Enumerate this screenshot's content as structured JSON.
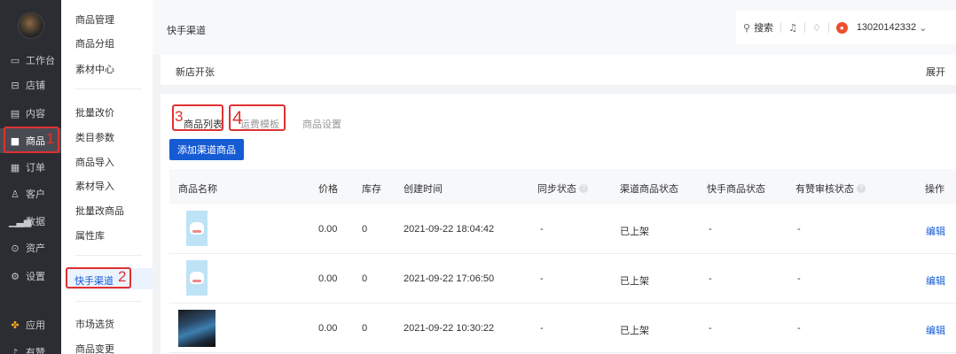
{
  "left_nav": {
    "items": [
      {
        "label": "工作台",
        "icon": "monitor-icon"
      },
      {
        "label": "店铺",
        "icon": "store-icon"
      },
      {
        "label": "内容",
        "icon": "document-icon"
      },
      {
        "label": "商品",
        "icon": "bag-icon"
      },
      {
        "label": "订单",
        "icon": "order-icon"
      },
      {
        "label": "客户",
        "icon": "user-icon"
      },
      {
        "label": "数据",
        "icon": "bar-chart-icon"
      },
      {
        "label": "资产",
        "icon": "money-icon"
      },
      {
        "label": "设置",
        "icon": "gear-icon"
      },
      {
        "label": "应用",
        "icon": "apps-icon"
      },
      {
        "label": "有赞",
        "icon": "youzan-icon"
      }
    ],
    "active_index": 3
  },
  "sub_nav": {
    "items": [
      "商品管理",
      "商品分组",
      "素材中心",
      "批量改价",
      "类目参数",
      "商品导入",
      "素材导入",
      "批量改商品",
      "属性库",
      "快手渠道",
      "市场选货",
      "商品变更"
    ],
    "active": "快手渠道"
  },
  "annotations": [
    "1",
    "2",
    "3",
    "4"
  ],
  "header": {
    "title": "快手渠道",
    "search": "搜索",
    "account": "13020142332"
  },
  "notice": {
    "text": "新店开张",
    "expand": "展开"
  },
  "tabs": [
    "商品列表",
    "运费模板",
    "商品设置"
  ],
  "add_button": "添加渠道商品",
  "table": {
    "columns": [
      "商品名称",
      "价格",
      "库存",
      "创建时间",
      "同步状态",
      "渠道商品状态",
      "快手商品状态",
      "有赞审核状态",
      "操作"
    ],
    "rows": [
      {
        "thumb": "cat-sticker",
        "price": "0.00",
        "stock": "0",
        "created": "2021-09-22 18:04:42",
        "sync": "-",
        "channel_status": "已上架",
        "ks_status": "-",
        "audit": "-",
        "action": "编辑"
      },
      {
        "thumb": "cat-sticker",
        "price": "0.00",
        "stock": "0",
        "created": "2021-09-22 17:06:50",
        "sync": "-",
        "channel_status": "已上架",
        "ks_status": "-",
        "audit": "-",
        "action": "编辑"
      },
      {
        "thumb": "sneaker-photo",
        "price": "0.00",
        "stock": "0",
        "created": "2021-09-22 10:30:22",
        "sync": "-",
        "channel_status": "已上架",
        "ks_status": "-",
        "audit": "-",
        "action": "编辑"
      }
    ]
  },
  "colors": {
    "primary": "#155bd4",
    "sidebar": "#2c2d33",
    "annotation": "#e03131"
  }
}
